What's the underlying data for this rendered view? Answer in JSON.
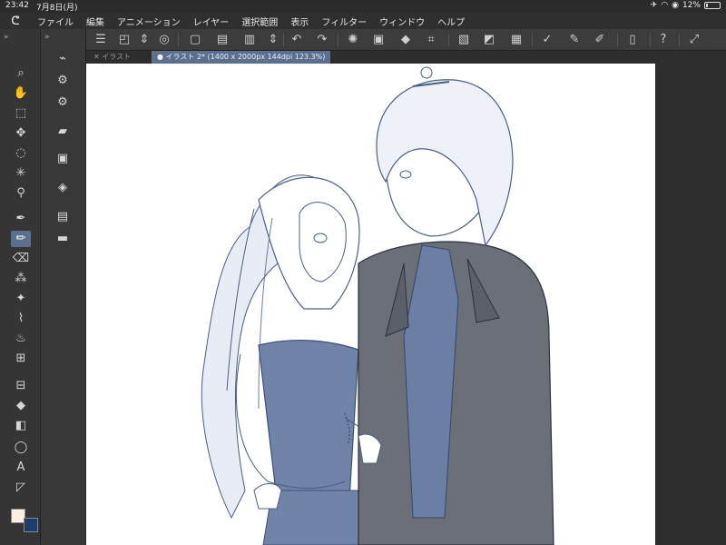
{
  "status": {
    "time": "23:42",
    "date": "7月8日(月)",
    "battery": "12%"
  },
  "menu": {
    "logo": "ᕦ",
    "items": [
      "ファイル",
      "編集",
      "アニメーション",
      "レイヤー",
      "選択範囲",
      "表示",
      "フィルター",
      "ウィンドウ",
      "ヘルプ"
    ]
  },
  "tabs": [
    {
      "label": "✕ イラスト"
    },
    {
      "label": "● イラスト 2* (1400 x 2000px 144dpi 123.3%)"
    }
  ],
  "colors": {
    "main": "#fbeee3",
    "sub": "#1c3c6e",
    "accent": "#5b6f8f"
  }
}
